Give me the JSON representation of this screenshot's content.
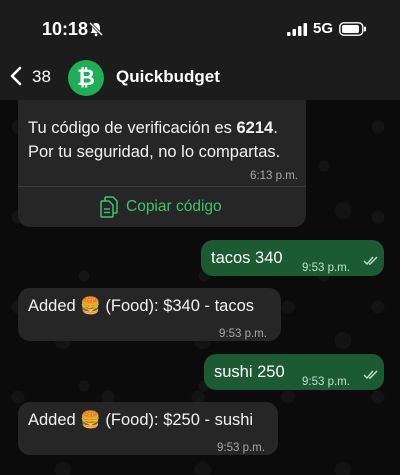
{
  "status": {
    "time": "10:18",
    "network": "5G"
  },
  "header": {
    "back_count": "38",
    "contact_name": "Quickbudget",
    "avatar_letter": "₿"
  },
  "messages": [
    {
      "type": "incoming",
      "line1_prefix": "Tu código de verificación es ",
      "code": "6214",
      "line1_suffix": ".",
      "line2": "Por tu seguridad, no lo compartas.",
      "time": "6:13 p.m.",
      "action": "Copiar código"
    },
    {
      "type": "outgoing",
      "text": "tacos 340",
      "time": "9:53 p.m."
    },
    {
      "type": "incoming",
      "text_prefix": "Added ",
      "emoji": "🍔",
      "text_suffix": " (Food): $340 - tacos",
      "time": "9:53 p.m."
    },
    {
      "type": "outgoing",
      "text": "sushi 250",
      "time": "9:53 p.m."
    },
    {
      "type": "incoming",
      "text_prefix": "Added ",
      "emoji": "🍔",
      "text_suffix": " (Food): $250 - sushi",
      "time": "9:53 p.m."
    }
  ],
  "colors": {
    "accent": "#3dc46b",
    "outgoing_bubble": "#1b5a33",
    "incoming_bubble": "#262626",
    "avatar": "#1fae55"
  }
}
